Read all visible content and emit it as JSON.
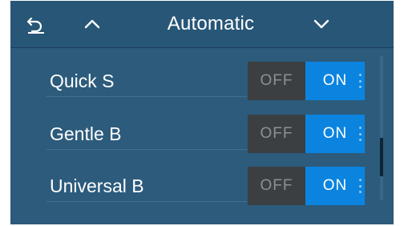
{
  "header": {
    "title": "Automatic",
    "back_icon": "back-arrow-icon",
    "up_icon": "chevron-up-icon",
    "down_icon": "chevron-down-icon"
  },
  "programs": [
    {
      "label": "Quick S",
      "off_label": "OFF",
      "on_label": "ON",
      "state": "on"
    },
    {
      "label": "Gentle B",
      "off_label": "OFF",
      "on_label": "ON",
      "state": "on"
    },
    {
      "label": "Universal B",
      "off_label": "OFF",
      "on_label": "ON",
      "state": "on"
    }
  ],
  "colors": {
    "background": "#2c5b7c",
    "toggle_on": "#0b84e0",
    "toggle_off": "#3b3f42"
  }
}
